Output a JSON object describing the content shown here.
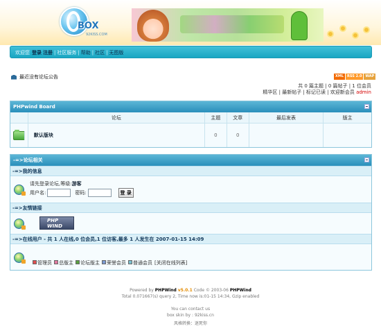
{
  "header": {
    "logo_text": "BOX",
    "logo_sub": "92KISS.COM"
  },
  "nav": {
    "guest_label": "欢迎您",
    "login": "登录",
    "register": "注册",
    "items": [
      "社区服务",
      "帮助",
      "社区",
      "无图版"
    ]
  },
  "notice": {
    "text": "最近没有论坛公告"
  },
  "badges": [
    "XML",
    "RSS 2.0",
    "WAP"
  ],
  "stats": {
    "text": "共 0 篇主题 | 0 篇帖子 | 1 位会员"
  },
  "quick_links": {
    "items": [
      "精华区",
      "最新帖子",
      "标记已读"
    ],
    "welcome_prefix": "欢迎新会员",
    "new_member": "admin"
  },
  "board": {
    "title": "PHPwind Board",
    "columns": [
      "论坛",
      "主题",
      "文章",
      "最后发表",
      "版主"
    ],
    "rows": [
      {
        "name": "默认版块",
        "topics": "0",
        "posts": "0",
        "last": "",
        "moderator": ""
      }
    ]
  },
  "forum_info": {
    "title": "-=>论坛相关",
    "my_info": {
      "heading": "-=>我的信息",
      "line_prefix": "请先登录论坛,等级:",
      "level": "游客",
      "username_label": "用户名:",
      "password_label": "密码:",
      "login_button": "登 录"
    },
    "links": {
      "heading": "-=>友情链接",
      "logo_text": "PHP WIND"
    },
    "online": {
      "heading": "-=>在线用户 - 共 1 人在线,0 位会员,1 位访客,最多 1 人发生在 2007-01-15 14:09",
      "legend": [
        {
          "label": "管理员",
          "color": "#e05050"
        },
        {
          "label": "总版主",
          "color": "#e07aa0"
        },
        {
          "label": "论坛版主",
          "color": "#5aa040"
        },
        {
          "label": "荣誉会员",
          "color": "#7a9ad0"
        },
        {
          "label": "普通会员",
          "color": "#7ac0d0"
        }
      ],
      "close_list": "[关闭在线列表]"
    }
  },
  "footer": {
    "line1_prefix": "Powered by",
    "brand": "PHPWind",
    "version": "v5.0.1",
    "code_text": "Code © 2003-06",
    "brand2": "PHPWind",
    "line2": "Total 0.071667(s) query 2, Time now is:01-15 14:34, Gzip enabled",
    "line3": "You can contact us",
    "line4": "box skin by : 92kiss.cn",
    "line5": "风格转换：迷死你"
  }
}
